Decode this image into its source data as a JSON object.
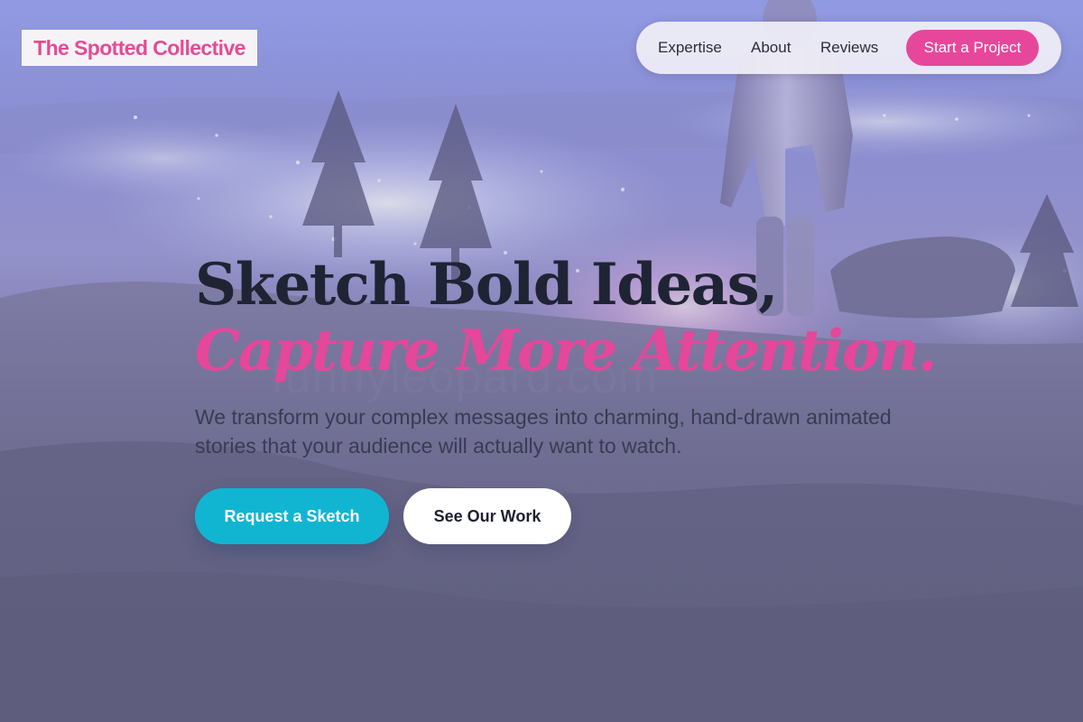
{
  "brand": {
    "name": "The Spotted Collective",
    "color": "#e44c93"
  },
  "nav": {
    "links": [
      "Expertise",
      "About",
      "Reviews"
    ],
    "cta_label": "Start a Project"
  },
  "hero": {
    "headline_line1": "Sketch Bold Ideas,",
    "headline_line2": "Capture More Attention.",
    "subtext": "We transform your complex messages into charming, hand-drawn animated stories that your audience will actually want to watch.",
    "primary_button": "Request a Sketch",
    "secondary_button": "See Our Work",
    "watermark": "funnyleopard.com"
  },
  "colors": {
    "accent_pink": "#e5479a",
    "accent_cyan": "#11b5d2",
    "headline_dark": "#1f2434"
  }
}
